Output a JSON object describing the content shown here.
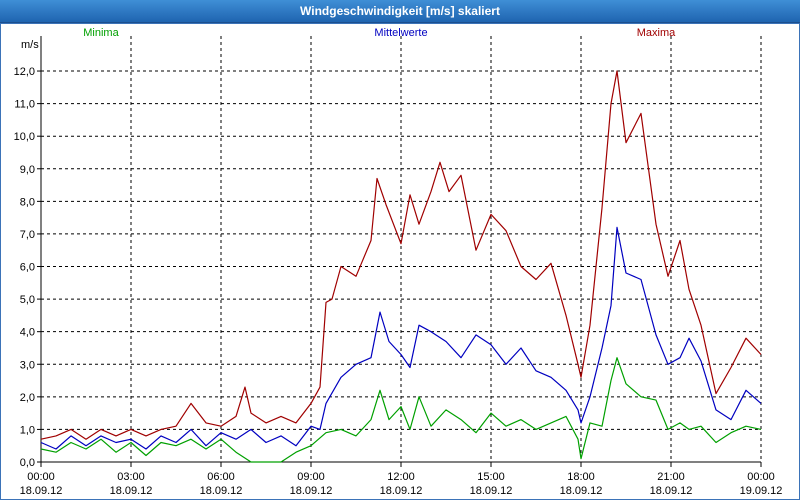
{
  "window": {
    "title": "Windgeschwindigkeit [m/s] skaliert"
  },
  "chart_data": {
    "type": "line",
    "title": "Windgeschwindigkeit [m/s] skaliert",
    "ylabel": "m/s",
    "ylim": [
      0,
      12.4
    ],
    "grid": true,
    "legend_placement": "top",
    "xlim": [
      0,
      24
    ],
    "yticks": [
      "0,0",
      "1,0",
      "2,0",
      "3,0",
      "4,0",
      "5,0",
      "6,0",
      "7,0",
      "8,0",
      "9,0",
      "10,0",
      "11,0",
      "12,0"
    ],
    "xticks": [
      {
        "time": "00:00",
        "date": "18.09.12"
      },
      {
        "time": "03:00",
        "date": "18.09.12"
      },
      {
        "time": "06:00",
        "date": "18.09.12"
      },
      {
        "time": "09:00",
        "date": "18.09.12"
      },
      {
        "time": "12:00",
        "date": "18.09.12"
      },
      {
        "time": "15:00",
        "date": "18.09.12"
      },
      {
        "time": "18:00",
        "date": "18.09.12"
      },
      {
        "time": "21:00",
        "date": "18.09.12"
      },
      {
        "time": "00:00",
        "date": "19.09.12"
      }
    ],
    "series": [
      {
        "name": "Minima",
        "color": "#00a000",
        "points": [
          [
            0,
            0.4
          ],
          [
            0.5,
            0.3
          ],
          [
            1,
            0.6
          ],
          [
            1.5,
            0.4
          ],
          [
            2,
            0.7
          ],
          [
            2.5,
            0.3
          ],
          [
            3,
            0.6
          ],
          [
            3.5,
            0.2
          ],
          [
            4,
            0.6
          ],
          [
            4.5,
            0.5
          ],
          [
            5,
            0.7
          ],
          [
            5.5,
            0.4
          ],
          [
            6,
            0.7
          ],
          [
            6.5,
            0.3
          ],
          [
            7,
            0.0
          ],
          [
            8,
            0.0
          ],
          [
            8.5,
            0.3
          ],
          [
            9,
            0.5
          ],
          [
            9.5,
            0.9
          ],
          [
            10,
            1.0
          ],
          [
            10.5,
            0.8
          ],
          [
            11,
            1.3
          ],
          [
            11.3,
            2.2
          ],
          [
            11.6,
            1.3
          ],
          [
            12,
            1.7
          ],
          [
            12.3,
            1.0
          ],
          [
            12.6,
            2.0
          ],
          [
            13,
            1.1
          ],
          [
            13.5,
            1.6
          ],
          [
            14,
            1.3
          ],
          [
            14.5,
            0.9
          ],
          [
            15,
            1.5
          ],
          [
            15.5,
            1.1
          ],
          [
            16,
            1.3
          ],
          [
            16.5,
            1.0
          ],
          [
            17,
            1.2
          ],
          [
            17.5,
            1.4
          ],
          [
            17.9,
            0.7
          ],
          [
            18,
            0.1
          ],
          [
            18.3,
            1.2
          ],
          [
            18.7,
            1.1
          ],
          [
            19,
            2.5
          ],
          [
            19.2,
            3.2
          ],
          [
            19.5,
            2.4
          ],
          [
            20,
            2.0
          ],
          [
            20.5,
            1.9
          ],
          [
            20.9,
            1.0
          ],
          [
            21.3,
            1.2
          ],
          [
            21.6,
            1.0
          ],
          [
            22,
            1.1
          ],
          [
            22.5,
            0.6
          ],
          [
            23,
            0.9
          ],
          [
            23.5,
            1.1
          ],
          [
            24,
            1.0
          ]
        ]
      },
      {
        "name": "Mittelwerte",
        "color": "#0000c0",
        "points": [
          [
            0,
            0.6
          ],
          [
            0.5,
            0.4
          ],
          [
            1,
            0.8
          ],
          [
            1.5,
            0.5
          ],
          [
            2,
            0.8
          ],
          [
            2.5,
            0.6
          ],
          [
            3,
            0.7
          ],
          [
            3.5,
            0.4
          ],
          [
            4,
            0.8
          ],
          [
            4.5,
            0.6
          ],
          [
            5,
            1.0
          ],
          [
            5.5,
            0.5
          ],
          [
            6,
            0.9
          ],
          [
            6.5,
            0.7
          ],
          [
            7,
            1.0
          ],
          [
            7.5,
            0.6
          ],
          [
            8,
            0.8
          ],
          [
            8.5,
            0.5
          ],
          [
            9,
            1.1
          ],
          [
            9.3,
            1.0
          ],
          [
            9.5,
            1.8
          ],
          [
            10,
            2.6
          ],
          [
            10.5,
            3.0
          ],
          [
            11,
            3.2
          ],
          [
            11.3,
            4.6
          ],
          [
            11.6,
            3.7
          ],
          [
            12,
            3.3
          ],
          [
            12.3,
            2.9
          ],
          [
            12.6,
            4.2
          ],
          [
            13,
            4.0
          ],
          [
            13.5,
            3.7
          ],
          [
            14,
            3.2
          ],
          [
            14.5,
            3.9
          ],
          [
            15,
            3.6
          ],
          [
            15.5,
            3.0
          ],
          [
            16,
            3.5
          ],
          [
            16.5,
            2.8
          ],
          [
            17,
            2.6
          ],
          [
            17.5,
            2.2
          ],
          [
            17.9,
            1.6
          ],
          [
            18,
            1.2
          ],
          [
            18.3,
            2.0
          ],
          [
            18.7,
            3.5
          ],
          [
            19,
            4.8
          ],
          [
            19.2,
            7.2
          ],
          [
            19.5,
            5.8
          ],
          [
            20,
            5.6
          ],
          [
            20.5,
            3.9
          ],
          [
            20.9,
            3.0
          ],
          [
            21.3,
            3.2
          ],
          [
            21.6,
            3.8
          ],
          [
            22,
            3.1
          ],
          [
            22.5,
            1.6
          ],
          [
            23,
            1.3
          ],
          [
            23.5,
            2.2
          ],
          [
            24,
            1.8
          ]
        ]
      },
      {
        "name": "Maxima",
        "color": "#a00000",
        "points": [
          [
            0,
            0.7
          ],
          [
            0.5,
            0.8
          ],
          [
            1,
            1.0
          ],
          [
            1.5,
            0.7
          ],
          [
            2,
            1.0
          ],
          [
            2.5,
            0.8
          ],
          [
            3,
            1.0
          ],
          [
            3.5,
            0.8
          ],
          [
            4,
            1.0
          ],
          [
            4.5,
            1.1
          ],
          [
            5,
            1.8
          ],
          [
            5.5,
            1.2
          ],
          [
            6,
            1.1
          ],
          [
            6.5,
            1.4
          ],
          [
            6.8,
            2.3
          ],
          [
            7,
            1.5
          ],
          [
            7.5,
            1.2
          ],
          [
            8,
            1.4
          ],
          [
            8.5,
            1.2
          ],
          [
            9,
            1.8
          ],
          [
            9.3,
            2.3
          ],
          [
            9.5,
            4.9
          ],
          [
            9.7,
            5.0
          ],
          [
            10,
            6.0
          ],
          [
            10.5,
            5.7
          ],
          [
            11,
            6.8
          ],
          [
            11.2,
            8.7
          ],
          [
            11.5,
            7.9
          ],
          [
            12,
            6.7
          ],
          [
            12.3,
            8.2
          ],
          [
            12.6,
            7.3
          ],
          [
            13,
            8.3
          ],
          [
            13.3,
            9.2
          ],
          [
            13.6,
            8.3
          ],
          [
            14,
            8.8
          ],
          [
            14.5,
            6.5
          ],
          [
            15,
            7.6
          ],
          [
            15.5,
            7.1
          ],
          [
            16,
            6.0
          ],
          [
            16.5,
            5.6
          ],
          [
            17,
            6.1
          ],
          [
            17.5,
            4.5
          ],
          [
            17.9,
            3.0
          ],
          [
            18,
            2.6
          ],
          [
            18.3,
            4.2
          ],
          [
            18.7,
            7.8
          ],
          [
            19,
            11.0
          ],
          [
            19.2,
            12.0
          ],
          [
            19.5,
            9.8
          ],
          [
            20,
            10.7
          ],
          [
            20.5,
            7.3
          ],
          [
            20.9,
            5.7
          ],
          [
            21.3,
            6.8
          ],
          [
            21.6,
            5.3
          ],
          [
            22,
            4.2
          ],
          [
            22.5,
            2.1
          ],
          [
            23,
            2.9
          ],
          [
            23.5,
            3.8
          ],
          [
            24,
            3.3
          ]
        ]
      }
    ]
  }
}
